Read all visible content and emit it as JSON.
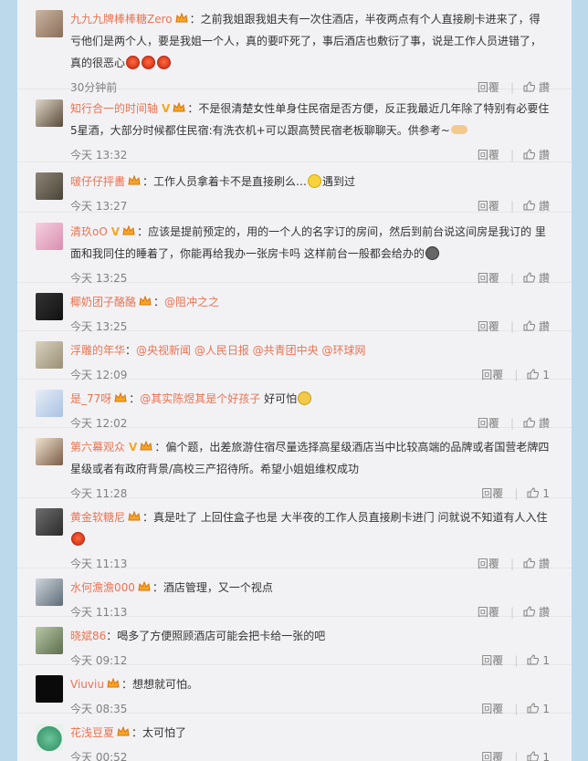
{
  "colors": {
    "accent": "#eb7350",
    "meta": "#808080",
    "background": "#bcd9ec",
    "panel": "#f2f2f5"
  },
  "icons": {
    "like": "thumbs-up-icon",
    "vip": "crown-icon",
    "verified": "v-badge-icon"
  },
  "comments": [
    {
      "user": "九九九牌棒棒糖Zero",
      "text": "：之前我姐跟我姐夫有一次住酒店，半夜两点有个人直接刷卡进来了，得亏他们是两个人，要是我姐一个人，真的要吓死了，事后酒店也敷衍了事，说是工作人员进错了，真的很恶心",
      "time": "30分钟前",
      "reply": "回覆",
      "like": "讚"
    },
    {
      "user": "知行合一的时间轴",
      "text": "：不是很清楚女性单身住民宿是否方便，反正我最近几年除了特别有必要住5星酒，大部分时候都住民宿:有洗衣机+可以跟高赞民宿老板聊聊天。供参考~",
      "time": "今天 13:32",
      "reply": "回覆",
      "like": "讚"
    },
    {
      "user": "啵仔仔抨畵",
      "text": "：工作人员拿着卡不是直接刷么…",
      "text2": "遇到过",
      "time": "今天 13:27",
      "reply": "回覆",
      "like": "讚"
    },
    {
      "user": "清玖oO",
      "text": "：应该是提前预定的，用的一个人的名字订的房间，然后到前台说这间房是我订的 里面和我同住的睡着了，你能再给我办一张房卡吗 这样前台一般都会给办的",
      "time": "今天 13:25",
      "reply": "回覆",
      "like": "讚"
    },
    {
      "user": "椰奶团子酪酪",
      "text": "：",
      "mention": "@阻冲之之",
      "time": "今天 13:25",
      "reply": "回覆",
      "like": "讚"
    },
    {
      "user": "浮雕的年华",
      "text": "：",
      "mention": "@央视新闻 @人民日报 @共青团中央 @环球网",
      "time": "今天 12:09",
      "reply": "回覆",
      "like": "1"
    },
    {
      "user": "是_77呀",
      "text": "：",
      "mention": "@其实陈煜其是个好孩子",
      "text2": " 好可怕",
      "time": "今天 12:02",
      "reply": "回覆",
      "like": "讚"
    },
    {
      "user": "第六幕观众",
      "text": "：偏个题，出差旅游住宿尽量选择高星级酒店当中比较高端的品牌或者国营老牌四星级或者有政府背景/高校三产招待所。希望小姐姐维权成功",
      "time": "今天 11:28",
      "reply": "回覆",
      "like": "1"
    },
    {
      "user": "黄金软糖尼",
      "text": "：真是吐了 上回住盒子也是 大半夜的工作人员直接刷卡进门 问就说不知道有人入住",
      "time": "今天 11:13",
      "reply": "回覆",
      "like": "讚"
    },
    {
      "user": "水何澹澹000",
      "text": "：酒店管理，又一个视点",
      "time": "今天 11:13",
      "reply": "回覆",
      "like": "讚"
    },
    {
      "user": "晓斌86",
      "text": "：喝多了方便照顾酒店可能会把卡给一张的吧",
      "time": "今天 09:12",
      "reply": "回覆",
      "like": "1"
    },
    {
      "user": "Viuviu",
      "text": "：想想就可怕。",
      "time": "今天 08:35",
      "reply": "回覆",
      "like": "1"
    },
    {
      "user": "花浅豆夏",
      "text": "：太可怕了",
      "time": "今天 00:52",
      "reply": "回覆",
      "like": "1"
    }
  ]
}
